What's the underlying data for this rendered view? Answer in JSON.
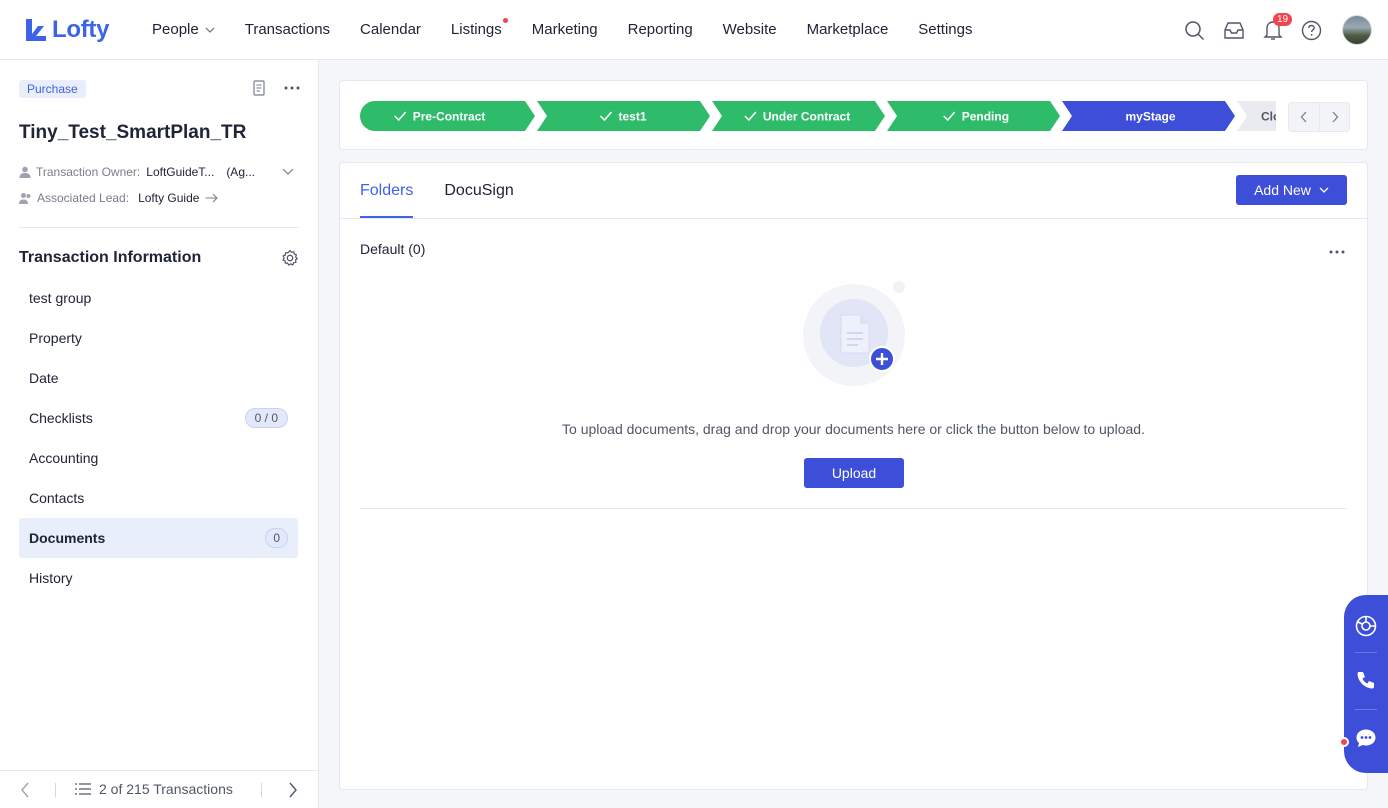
{
  "brand": {
    "name": "Lofty",
    "accent": "#3d63e6",
    "button_color": "#3d4ed8",
    "stage_done_color": "#2fbc6a",
    "stage_current_color": "#3d4ed8"
  },
  "nav": {
    "items": [
      {
        "label": "People",
        "has_dropdown": true
      },
      {
        "label": "Transactions"
      },
      {
        "label": "Calendar"
      },
      {
        "label": "Listings",
        "has_dot": true
      },
      {
        "label": "Marketing"
      },
      {
        "label": "Reporting"
      },
      {
        "label": "Website"
      },
      {
        "label": "Marketplace"
      },
      {
        "label": "Settings"
      }
    ],
    "icons": [
      "search-icon",
      "inbox-icon",
      "bell-icon",
      "help-icon"
    ],
    "notification_count": "19"
  },
  "sidebar": {
    "tag": "Purchase",
    "title": "Tiny_Test_SmartPlan_TR",
    "owner_label": "Transaction Owner:",
    "owner_value": "LoftGuideT...",
    "owner_suffix": "(Ag...",
    "lead_label": "Associated Lead:",
    "lead_value": "Lofty Guide",
    "section_title": "Transaction Information",
    "items": [
      {
        "label": "test group"
      },
      {
        "label": "Property"
      },
      {
        "label": "Date"
      },
      {
        "label": "Checklists",
        "count": "0 / 0"
      },
      {
        "label": "Accounting"
      },
      {
        "label": "Contacts"
      },
      {
        "label": "Documents",
        "count": "0",
        "active": true
      },
      {
        "label": "History"
      }
    ],
    "footer_text": "2 of 215 Transactions"
  },
  "stages": [
    {
      "label": "Pre-Contract",
      "state": "done"
    },
    {
      "label": "test1",
      "state": "done"
    },
    {
      "label": "Under Contract",
      "state": "done"
    },
    {
      "label": "Pending",
      "state": "done"
    },
    {
      "label": "myStage",
      "state": "current"
    },
    {
      "label": "Clo",
      "state": "upcoming"
    }
  ],
  "main": {
    "tabs": [
      {
        "label": "Folders",
        "active": true
      },
      {
        "label": "DocuSign"
      }
    ],
    "add_new_label": "Add New",
    "folder_title": "Default (0)",
    "empty_text": "To upload documents, drag and drop your documents here or click the button below to upload.",
    "upload_label": "Upload"
  },
  "float_widget": {
    "icons": [
      "assistant-icon",
      "phone-icon",
      "chat-icon"
    ]
  }
}
